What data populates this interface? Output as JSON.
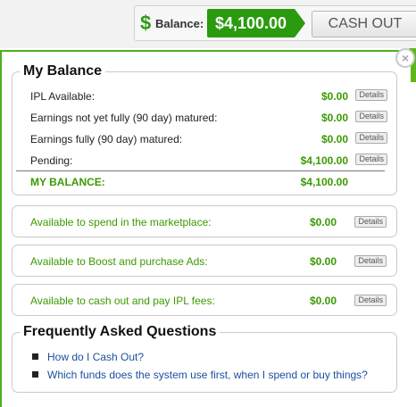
{
  "header": {
    "currency_icon": "dollar-icon",
    "balance_label": "Balance:",
    "balance_amount": "$4,100.00",
    "cashout_label": "CASH OUT",
    "accent_color": "#2a9a0f"
  },
  "panel": {
    "close_symbol": "×",
    "my_balance": {
      "legend": "My Balance",
      "rows": [
        {
          "label": "IPL Available:",
          "amount": "$0.00",
          "details": "Details"
        },
        {
          "label": "Earnings not yet fully (90 day) matured:",
          "amount": "$0.00",
          "details": "Details"
        },
        {
          "label": "Earnings fully (90 day) matured:",
          "amount": "$0.00",
          "details": "Details"
        },
        {
          "label": "Pending:",
          "amount": "$4,100.00",
          "details": "Details"
        }
      ],
      "total": {
        "label": "MY BALANCE:",
        "amount": "$4,100.00"
      }
    },
    "available": [
      {
        "label": "Available to spend in the marketplace:",
        "amount": "$0.00",
        "details": "Details"
      },
      {
        "label": "Available to Boost and purchase Ads:",
        "amount": "$0.00",
        "details": "Details"
      },
      {
        "label": "Available to cash out and pay IPL fees:",
        "amount": "$0.00",
        "details": "Details"
      }
    ],
    "faq": {
      "legend": "Frequently Asked Questions",
      "items": [
        "How do I Cash Out?",
        "Which funds does the system use first, when I spend or buy things?"
      ]
    }
  }
}
